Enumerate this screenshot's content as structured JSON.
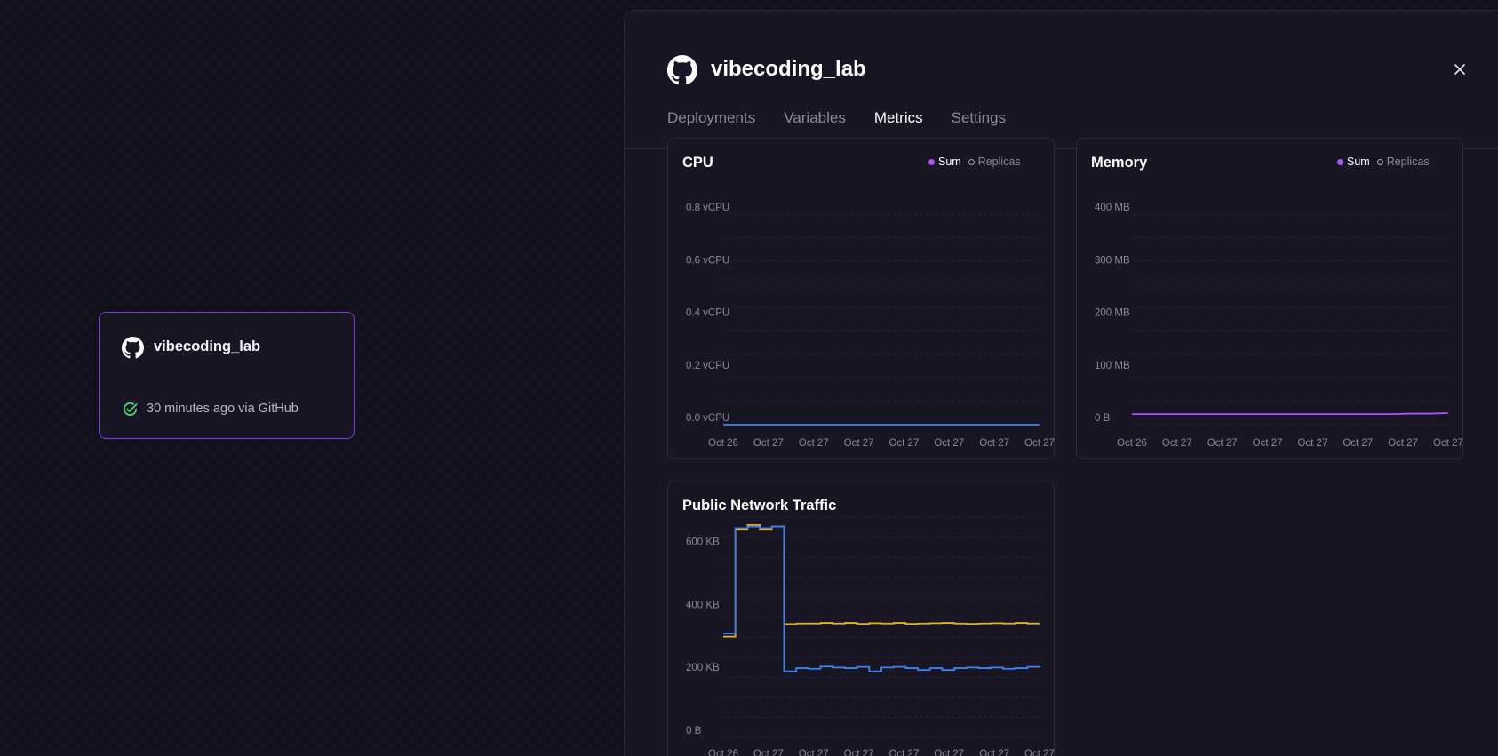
{
  "canvas": {
    "service_card": {
      "name": "vibecoding_lab",
      "status_text": "30 minutes ago via GitHub",
      "icon": "github-icon",
      "status_icon": "check-circle-icon",
      "border_color": "#7c3aed"
    }
  },
  "panel": {
    "title": "vibecoding_lab",
    "icon": "github-icon",
    "close_icon": "close-icon",
    "tabs": [
      {
        "label": "Deployments",
        "active": false
      },
      {
        "label": "Variables",
        "active": false
      },
      {
        "label": "Metrics",
        "active": true
      },
      {
        "label": "Settings",
        "active": false
      }
    ]
  },
  "colors": {
    "accent": "#a855f7",
    "line_blue": "#3b82f6",
    "line_orange": "#eab308",
    "line_purple": "#a855f7",
    "grid": "#2a2836"
  },
  "chart_data": [
    {
      "id": "cpu",
      "type": "line",
      "title": "CPU",
      "legend": [
        "Sum",
        "Replicas"
      ],
      "legend_active": "Sum",
      "y_ticks": [
        "0.0 vCPU",
        "0.2 vCPU",
        "0.4 vCPU",
        "0.6 vCPU",
        "0.8 vCPU"
      ],
      "ylim": [
        0,
        0.8
      ],
      "x_ticks": [
        "Oct 26",
        "Oct 27",
        "Oct 27",
        "Oct 27",
        "Oct 27",
        "Oct 27",
        "Oct 27",
        "Oct 27"
      ],
      "series": [
        {
          "color": "#3b82f6",
          "values": [
            0,
            0,
            0,
            0,
            0,
            0,
            0,
            0,
            0,
            0
          ]
        }
      ]
    },
    {
      "id": "memory",
      "type": "line",
      "title": "Memory",
      "legend": [
        "Sum",
        "Replicas"
      ],
      "legend_active": "Sum",
      "y_ticks": [
        "0 B",
        "100 MB",
        "200 MB",
        "300 MB",
        "400 MB"
      ],
      "ylim": [
        0,
        400
      ],
      "x_ticks": [
        "Oct 26",
        "Oct 27",
        "Oct 27",
        "Oct 27",
        "Oct 27",
        "Oct 27",
        "Oct 27",
        "Oct 27"
      ],
      "series": [
        {
          "color": "#a855f7",
          "values": [
            20,
            20,
            20,
            20,
            20,
            20,
            20,
            20,
            20,
            20,
            20,
            20,
            20,
            20,
            20,
            21,
            21,
            22
          ]
        }
      ]
    },
    {
      "id": "network",
      "type": "line",
      "title": "Public Network Traffic",
      "y_ticks": [
        "0 B",
        "200 KB",
        "400 KB",
        "600 KB"
      ],
      "ylim": [
        0,
        700
      ],
      "x_ticks": [
        "Oct 26",
        "Oct 27",
        "Oct 27",
        "Oct 27",
        "Oct 27",
        "Oct 27",
        "Oct 27",
        "Oct 27"
      ],
      "series": [
        {
          "color": "#eab308",
          "step": true,
          "values": [
            320,
            660,
            675,
            660,
            670,
            360,
            362,
            362,
            364,
            362,
            364,
            361,
            363,
            362,
            364,
            361,
            362,
            363,
            364,
            362,
            361,
            362,
            363,
            362,
            364,
            362,
            362
          ]
        },
        {
          "color": "#3b82f6",
          "step": true,
          "values": [
            330,
            665,
            670,
            665,
            670,
            210,
            220,
            218,
            225,
            222,
            220,
            224,
            210,
            222,
            224,
            220,
            214,
            220,
            214,
            220,
            222,
            220,
            222,
            218,
            220,
            224,
            222
          ]
        }
      ]
    }
  ]
}
